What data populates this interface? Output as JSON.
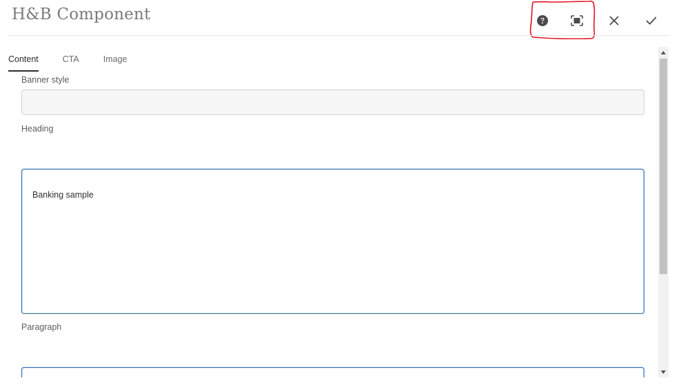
{
  "dialog": {
    "title": "H&B Component",
    "toolbar": {
      "help": "help-icon",
      "fullscreen": "fullscreen-icon",
      "cancel": "close-icon",
      "done": "checkmark-icon"
    }
  },
  "tabs": [
    {
      "label": "Content",
      "active": true
    },
    {
      "label": "CTA",
      "active": false
    },
    {
      "label": "Image",
      "active": false
    }
  ],
  "fields": {
    "banner_style": {
      "label": "Banner style",
      "value": ""
    },
    "heading": {
      "label": "Heading",
      "value": "Banking sample"
    },
    "paragraph": {
      "label": "Paragraph",
      "value": ""
    }
  },
  "colors": {
    "annotation": "#e0101f",
    "focus_border": "#2d6db5",
    "active_tab_underline": "#2c2c2c"
  }
}
